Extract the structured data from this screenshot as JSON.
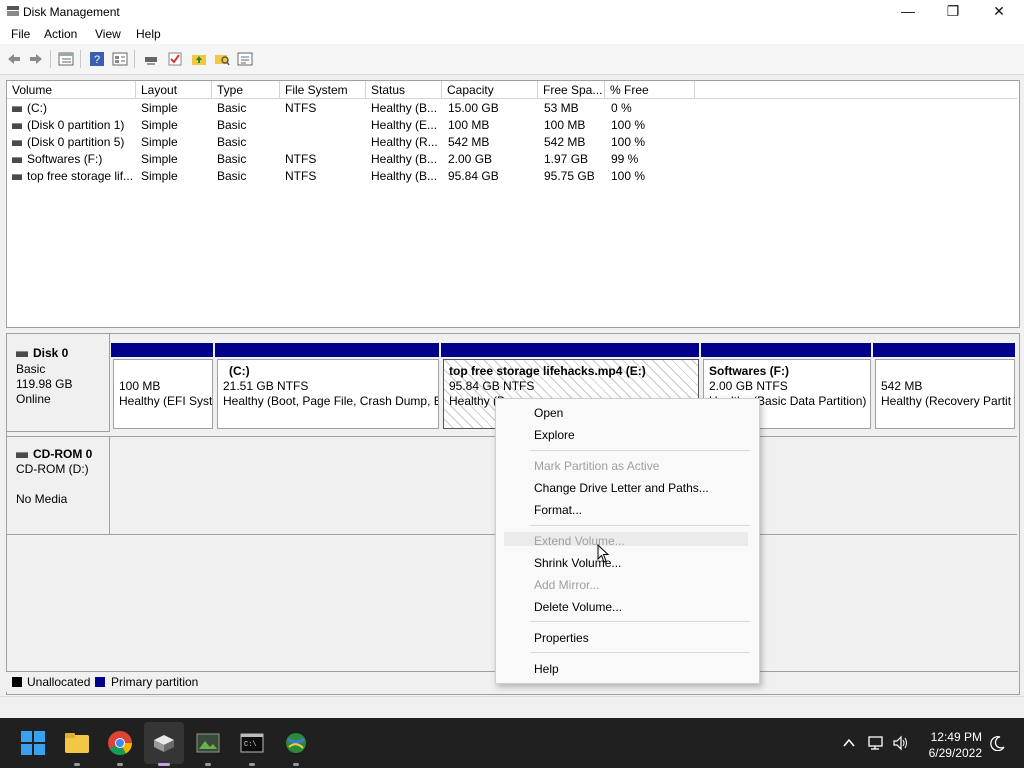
{
  "window": {
    "title": "Disk Management",
    "minimize": "—",
    "maximize": "❐",
    "close": "✕"
  },
  "menu": [
    "File",
    "Action",
    "View",
    "Help"
  ],
  "toolbar_icons": [
    "back-icon",
    "forward-icon",
    "list-view-icon",
    "help-icon",
    "disk-list-icon",
    "connect-icon",
    "check-icon",
    "folder-up-icon",
    "search-folder-icon",
    "properties-icon"
  ],
  "volume_table": {
    "headers": [
      "Volume",
      "Layout",
      "Type",
      "File System",
      "Status",
      "Capacity",
      "Free Spa...",
      "% Free"
    ],
    "rows": [
      [
        "(C:)",
        "Simple",
        "Basic",
        "NTFS",
        "Healthy (B...",
        "15.00 GB",
        "53 MB",
        "0 %"
      ],
      [
        "(Disk 0 partition 1)",
        "Simple",
        "Basic",
        "",
        "Healthy (E...",
        "100 MB",
        "100 MB",
        "100 %"
      ],
      [
        "(Disk 0 partition 5)",
        "Simple",
        "Basic",
        "",
        "Healthy (R...",
        "542 MB",
        "542 MB",
        "100 %"
      ],
      [
        "Softwares (F:)",
        "Simple",
        "Basic",
        "NTFS",
        "Healthy (B...",
        "2.00 GB",
        "1.97 GB",
        "99 %"
      ],
      [
        "top free storage lif...",
        "Simple",
        "Basic",
        "NTFS",
        "Healthy (B...",
        "95.84 GB",
        "95.75 GB",
        "100 %"
      ]
    ]
  },
  "disk0": {
    "name": "Disk 0",
    "type": "Basic",
    "size": "119.98 GB",
    "state": "Online",
    "partitions": [
      {
        "title": "",
        "line1": "100 MB",
        "line2": "Healthy (EFI Syst"
      },
      {
        "title": "(C:)",
        "line1": "21.51 GB NTFS",
        "line2": "Healthy (Boot, Page File, Crash Dump, B"
      },
      {
        "title": "top free storage lifehacks.mp4  (E:)",
        "line1": "95.84 GB NTFS",
        "line2": "Healthy (B"
      },
      {
        "title": "Softwares  (F:)",
        "line1": "2.00 GB NTFS",
        "line2": "Healthy (Basic Data Partition)"
      },
      {
        "title": "",
        "line1": "542 MB",
        "line2": "Healthy (Recovery Partit"
      }
    ]
  },
  "cdrom0": {
    "name": "CD-ROM 0",
    "drive": "CD-ROM (D:)",
    "media": "No Media"
  },
  "legend": {
    "unallocated": "Unallocated",
    "primary": "Primary partition",
    "unallocated_color": "#000000",
    "primary_color": "#00008b"
  },
  "context_menu": {
    "items": [
      {
        "label": "Open",
        "enabled": true
      },
      {
        "label": "Explore",
        "enabled": true
      },
      {
        "label": "Mark Partition as Active",
        "enabled": false
      },
      {
        "label": "Change Drive Letter and Paths...",
        "enabled": true
      },
      {
        "label": "Format...",
        "enabled": true
      },
      {
        "label": "Extend Volume...",
        "enabled": false
      },
      {
        "label": "Shrink Volume...",
        "enabled": true
      },
      {
        "label": "Add Mirror...",
        "enabled": false
      },
      {
        "label": "Delete Volume...",
        "enabled": true
      },
      {
        "label": "Properties",
        "enabled": true
      },
      {
        "label": "Help",
        "enabled": true
      }
    ]
  },
  "taskbar": {
    "apps": [
      "windows-start-icon",
      "file-explorer-icon",
      "chrome-icon",
      "disk-management-icon",
      "image-viewer-icon",
      "terminal-icon",
      "network-globe-icon"
    ],
    "time": "12:49 PM",
    "date": "6/29/2022"
  }
}
